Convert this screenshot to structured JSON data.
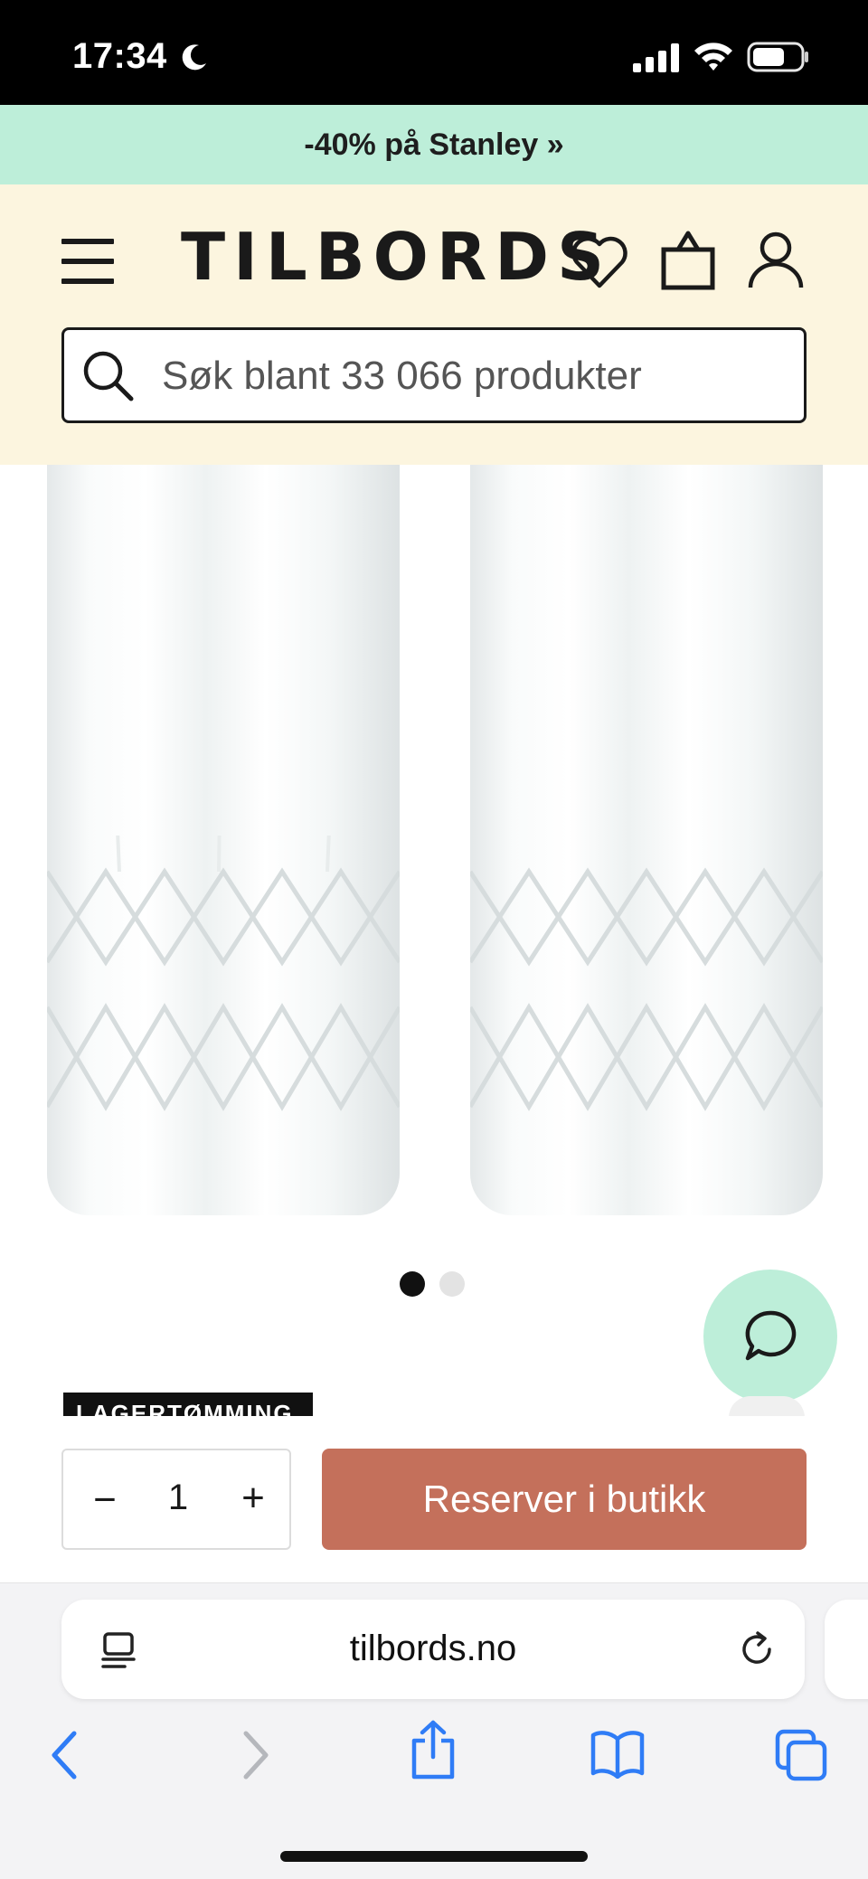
{
  "status_bar": {
    "time": "17:34",
    "icons": [
      "moon-icon",
      "signal-icon",
      "wifi-icon",
      "battery-icon"
    ]
  },
  "promo_banner": {
    "text": "-40% på Stanley »",
    "background": "#bdeed9"
  },
  "header": {
    "logo": "TILBORDS",
    "icons": [
      "menu-icon",
      "heart-icon",
      "cart-icon",
      "account-icon"
    ],
    "background": "#fcf5df",
    "search": {
      "placeholder": "Søk blant 33 066 produkter",
      "value": ""
    }
  },
  "gallery": {
    "image": "two cut crystal highball glasses",
    "slide_count": 2,
    "active_slide": 1
  },
  "product": {
    "badge": "LAGERTØMMING"
  },
  "purchase": {
    "quantity": "1",
    "minus_label": "−",
    "plus_label": "+",
    "reserve_label": "Reserver i butikk",
    "reserve_color": "#c4705b"
  },
  "chat": {
    "icon": "chat-bubble-icon",
    "background": "#bdeed9"
  },
  "browser": {
    "url": "tilbords.no",
    "accent": "#2f7cf6",
    "toolbar_icons": [
      "back-icon",
      "forward-icon",
      "share-icon",
      "bookmarks-icon",
      "tabs-icon"
    ]
  }
}
